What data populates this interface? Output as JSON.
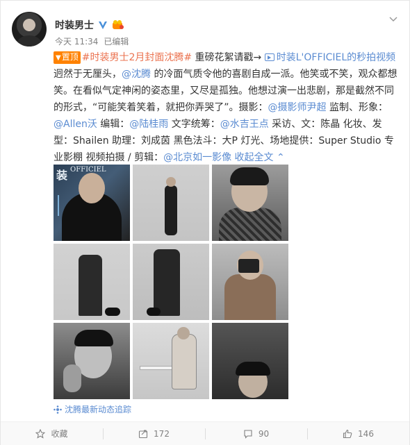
{
  "post": {
    "author": "时装男士",
    "time": "今天 11:34",
    "edited": "已编辑",
    "top_tag": "置顶",
    "hashtag": "#时装男士2月封面沈腾#",
    "lead": " 重磅花絮请戳→ ",
    "video_link": "时装L'OFFICIEL的秒拍视频",
    "text_1": " 迥然于无厘头，",
    "mention_shenteng": "@沈腾",
    "text_2": " 的冷面气质令他的喜剧自成一派。他笑或不笑，观众都想笑。在看似气定神闲的姿态里，又尽是孤独。他想过演一出悲剧，那是截然不同的形式，“可能笑着笑着，就把你弄哭了”。摄影：",
    "mention_photographer": "@摄影师尹超",
    "text_3": " 监制、形象：",
    "mention_allen": "@Allen沃",
    "text_4": " 编辑：",
    "mention_editor": "@陆桂雨",
    "text_5": " 文字统筹：",
    "mention_writer": "@水吉王点",
    "text_6": " 采访、文：陈晶 化妆、发型：Shailen 助理：刘成茵 黑色法斗：大P 灯光、场地提供：Super Studio 专业影棚 视频拍摄 / 剪辑：",
    "mention_video": "@北京如一影像",
    "collapse": "收起全文",
    "follow_link": "沈腾最新动态追踪"
  },
  "cover": {
    "mag_title": "装",
    "mag_brand": "OFFICIEL"
  },
  "photos": [
    "cover",
    "standing",
    "closeup",
    "coat-dog",
    "coat-dog-2",
    "camera",
    "hand-face",
    "table",
    "portrait"
  ],
  "actions": {
    "favorite": "收藏",
    "repost": "172",
    "comment": "90",
    "like": "146"
  },
  "colors": {
    "link_orange": "#eb7350",
    "link_blue": "#5a8bd1",
    "top_tag": "#ff8200"
  }
}
